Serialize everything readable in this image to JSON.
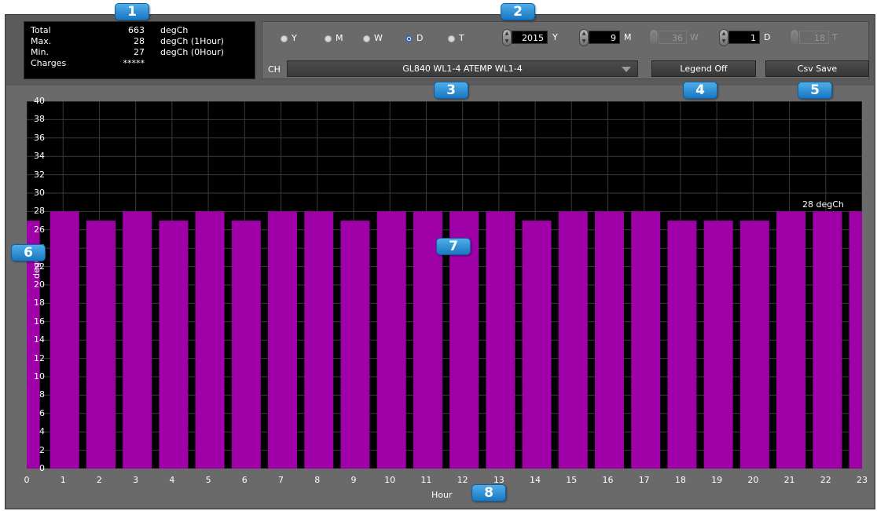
{
  "stats": [
    {
      "label": "Total",
      "value": "663",
      "unit": "degCh"
    },
    {
      "label": "Max.",
      "value": "28",
      "unit": "degCh (1Hour)"
    },
    {
      "label": "Min.",
      "value": "27",
      "unit": "degCh (0Hour)"
    },
    {
      "label": "Charges",
      "value": "*****",
      "unit": ""
    }
  ],
  "period_radios": [
    {
      "label": "Y",
      "selected": false
    },
    {
      "label": "M",
      "selected": false
    },
    {
      "label": "W",
      "selected": false
    },
    {
      "label": "D",
      "selected": true
    },
    {
      "label": "T",
      "selected": false
    }
  ],
  "spinners": [
    {
      "value": "2015",
      "unit": "Y",
      "enabled": true
    },
    {
      "value": "9",
      "unit": "M",
      "enabled": true
    },
    {
      "value": "36",
      "unit": "W",
      "enabled": false
    },
    {
      "value": "1",
      "unit": "D",
      "enabled": true
    },
    {
      "value": "18",
      "unit": "T",
      "enabled": false
    }
  ],
  "channel": {
    "label": "CH",
    "selected": "GL840 WL1-4 ATEMP  WL1-4"
  },
  "buttons": {
    "legend": "Legend Off",
    "csv": "Csv Save"
  },
  "badges": [
    "1",
    "2",
    "3",
    "4",
    "5",
    "6",
    "7",
    "8"
  ],
  "colors": {
    "bar": "#a000a8",
    "plot_bg": "#000000",
    "grid": "#3a3a3a",
    "badge": "#2a8fd6"
  },
  "chart_data": {
    "type": "bar",
    "categories": [
      "0",
      "1",
      "2",
      "3",
      "4",
      "5",
      "6",
      "7",
      "8",
      "9",
      "10",
      "11",
      "12",
      "13",
      "14",
      "15",
      "16",
      "17",
      "18",
      "19",
      "20",
      "21",
      "22",
      "23"
    ],
    "values": [
      27,
      28,
      27,
      28,
      27,
      28,
      27,
      28,
      28,
      27,
      28,
      28,
      28,
      28,
      27,
      28,
      28,
      28,
      27,
      27,
      27,
      28,
      28,
      28
    ],
    "xlabel": "Hour",
    "ylabel": "degCh",
    "ylim": [
      0,
      40
    ],
    "yticks": [
      "0",
      "2",
      "4",
      "6",
      "8",
      "10",
      "12",
      "14",
      "16",
      "18",
      "20",
      "22",
      "24",
      "26",
      "28",
      "30",
      "32",
      "34",
      "36",
      "38",
      "40"
    ],
    "legend": "28 degCh",
    "legend_position": "top-right",
    "grid": true
  }
}
